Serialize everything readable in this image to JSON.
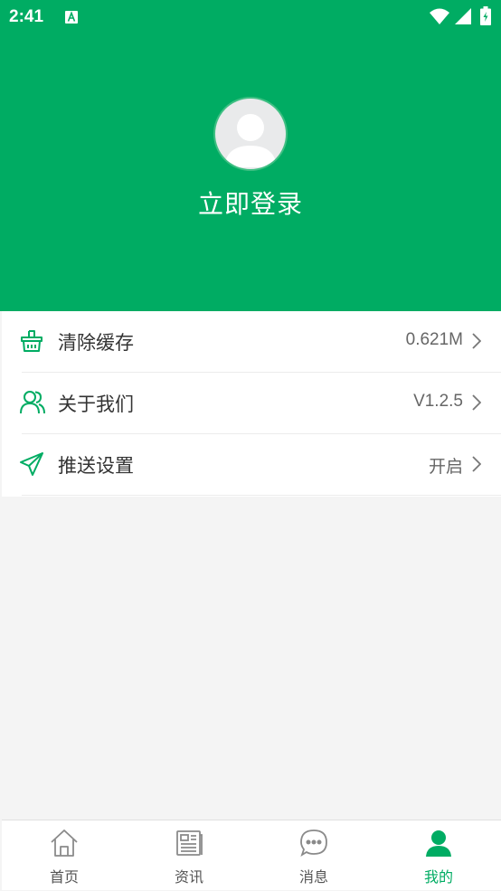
{
  "status_bar": {
    "time": "2:41"
  },
  "profile": {
    "login_label": "立即登录"
  },
  "menu": [
    {
      "label": "清除缓存",
      "value": "0.621M",
      "icon": "basket-icon"
    },
    {
      "label": "关于我们",
      "value": "V1.2.5",
      "icon": "users-icon"
    },
    {
      "label": "推送设置",
      "value": "开启",
      "icon": "send-icon"
    }
  ],
  "tabbar": [
    {
      "label": "首页",
      "icon": "home-icon",
      "active": false
    },
    {
      "label": "资讯",
      "icon": "news-icon",
      "active": false
    },
    {
      "label": "消息",
      "icon": "message-icon",
      "active": false
    },
    {
      "label": "我的",
      "icon": "user-icon",
      "active": true
    }
  ],
  "colors": {
    "primary": "#00ac63",
    "background": "#f4f4f4",
    "tab_inactive": "#555555"
  }
}
